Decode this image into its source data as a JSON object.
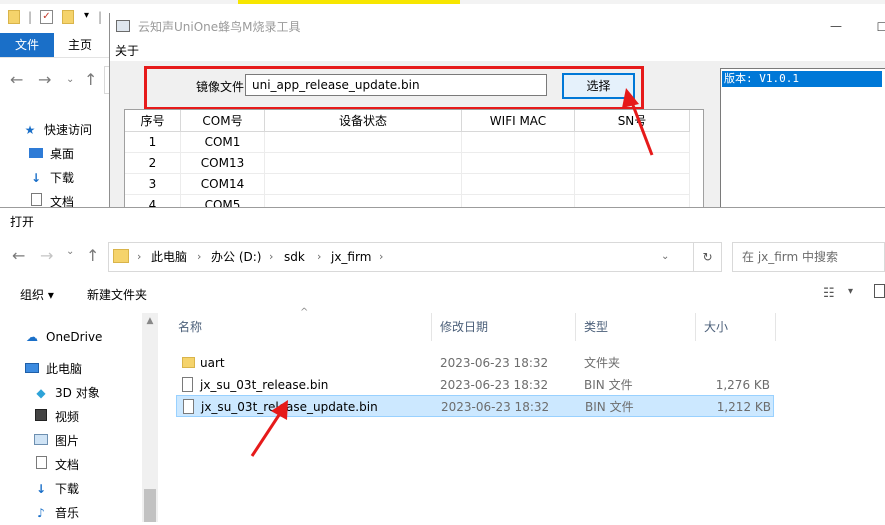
{
  "background_explorer": {
    "file_tab": "文件",
    "home_tab": "主页",
    "quick_access": "快速访问",
    "desktop": "桌面",
    "downloads": "下载",
    "documents": "文档"
  },
  "tool": {
    "title": "云知声UniOne蜂鸟M烧录工具",
    "menu_about": "关于",
    "image_file_label": "镜像文件:",
    "image_file_value": "uni_app_release_update.bin",
    "select_button": "选择",
    "version": "版本: V1.0.1",
    "grid": {
      "headers": [
        "序号",
        "COM号",
        "设备状态",
        "WIFI MAC",
        "SN号"
      ],
      "rows": [
        [
          "1",
          "COM1",
          "",
          "",
          ""
        ],
        [
          "2",
          "COM13",
          "",
          "",
          ""
        ],
        [
          "3",
          "COM14",
          "",
          "",
          ""
        ],
        [
          "4",
          "COM5",
          "",
          "",
          ""
        ]
      ]
    }
  },
  "dialog": {
    "title": "打开",
    "breadcrumb": [
      "此电脑",
      "办公 (D:)",
      "sdk",
      "jx_firm"
    ],
    "search_placeholder": "在 jx_firm 中搜索",
    "organize": "组织 ▾",
    "new_folder": "新建文件夹",
    "nav_items": [
      {
        "label": "OneDrive",
        "icon": "cloud-icon"
      },
      {
        "label": "此电脑",
        "icon": "computer-icon"
      },
      {
        "label": "3D 对象",
        "icon": "cube-icon"
      },
      {
        "label": "视频",
        "icon": "video-icon"
      },
      {
        "label": "图片",
        "icon": "picture-icon"
      },
      {
        "label": "文档",
        "icon": "document-icon"
      },
      {
        "label": "下载",
        "icon": "download-icon"
      },
      {
        "label": "音乐",
        "icon": "music-icon"
      }
    ],
    "columns": [
      "名称",
      "修改日期",
      "类型",
      "大小"
    ],
    "files": [
      {
        "name": "uart",
        "date": "2023-06-23 18:32",
        "type": "文件夹",
        "size": "",
        "kind": "folder"
      },
      {
        "name": "jx_su_03t_release.bin",
        "date": "2023-06-23 18:32",
        "type": "BIN 文件",
        "size": "1,276 KB",
        "kind": "file"
      },
      {
        "name": "jx_su_03t_release_update.bin",
        "date": "2023-06-23 18:32",
        "type": "BIN 文件",
        "size": "1,212 KB",
        "kind": "file",
        "selected": true
      }
    ]
  },
  "colors": {
    "highlight_red": "#e61a1a",
    "selection_blue": "#cce8ff",
    "accent_blue": "#0078d7"
  }
}
